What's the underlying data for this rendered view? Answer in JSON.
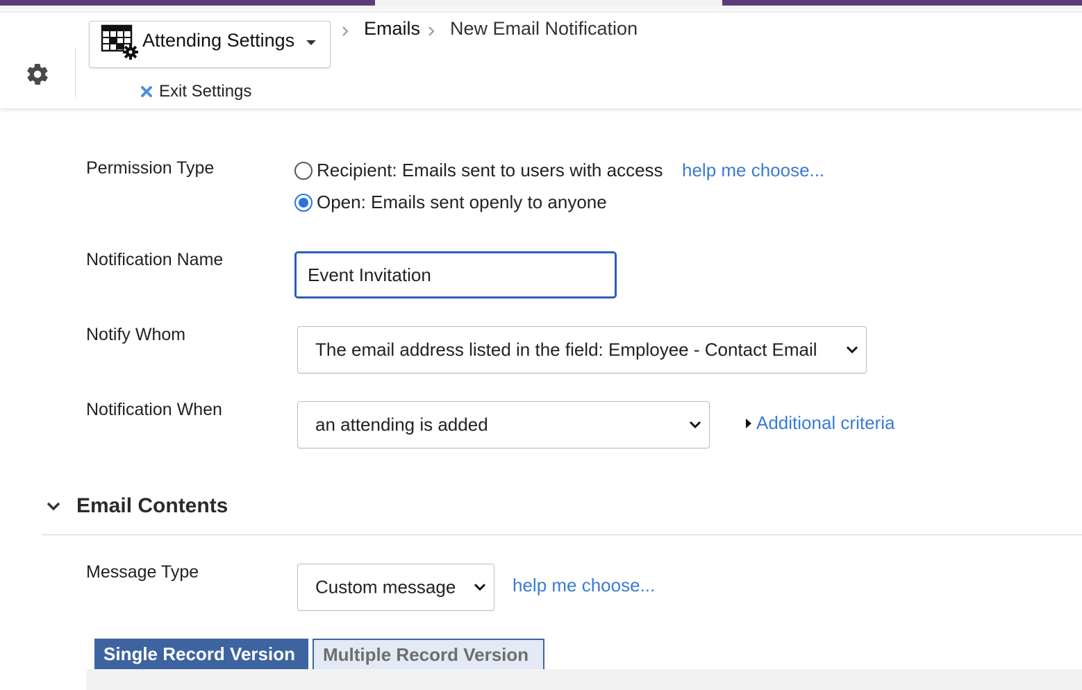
{
  "header": {
    "app_selector_label": "Attending Settings",
    "exit_label": "Exit Settings",
    "breadcrumbs": [
      "Emails",
      "New Email Notification"
    ]
  },
  "form": {
    "permission_type": {
      "label": "Permission Type",
      "options": [
        {
          "label": "Recipient: Emails sent to users with access",
          "checked": false
        },
        {
          "label": "Open: Emails sent openly to anyone",
          "checked": true
        }
      ],
      "help_link": "help me choose..."
    },
    "notification_name": {
      "label": "Notification Name",
      "value": "Event Invitation"
    },
    "notify_whom": {
      "label": "Notify Whom",
      "selected": "The email address listed in the field: Employee - Contact Email"
    },
    "notification_when": {
      "label": "Notification When",
      "selected": "an attending is added",
      "additional_criteria": "Additional criteria"
    }
  },
  "email_contents": {
    "title": "Email Contents",
    "message_type": {
      "label": "Message Type",
      "selected": "Custom message",
      "help_link": "help me choose..."
    },
    "tabs": [
      {
        "label": "Single Record Version",
        "active": true
      },
      {
        "label": "Multiple Record Version",
        "active": false
      }
    ]
  },
  "colors": {
    "brand_purple": "#5b3c78",
    "link_blue": "#3a7bd5",
    "focus_blue": "#2b5fb8",
    "tab_active": "#3d64a0"
  },
  "icons": {
    "settings": "gear-icon",
    "app": "grid-settings-icon",
    "exit": "close-x-icon",
    "dropdown": "chevron-down-icon"
  }
}
